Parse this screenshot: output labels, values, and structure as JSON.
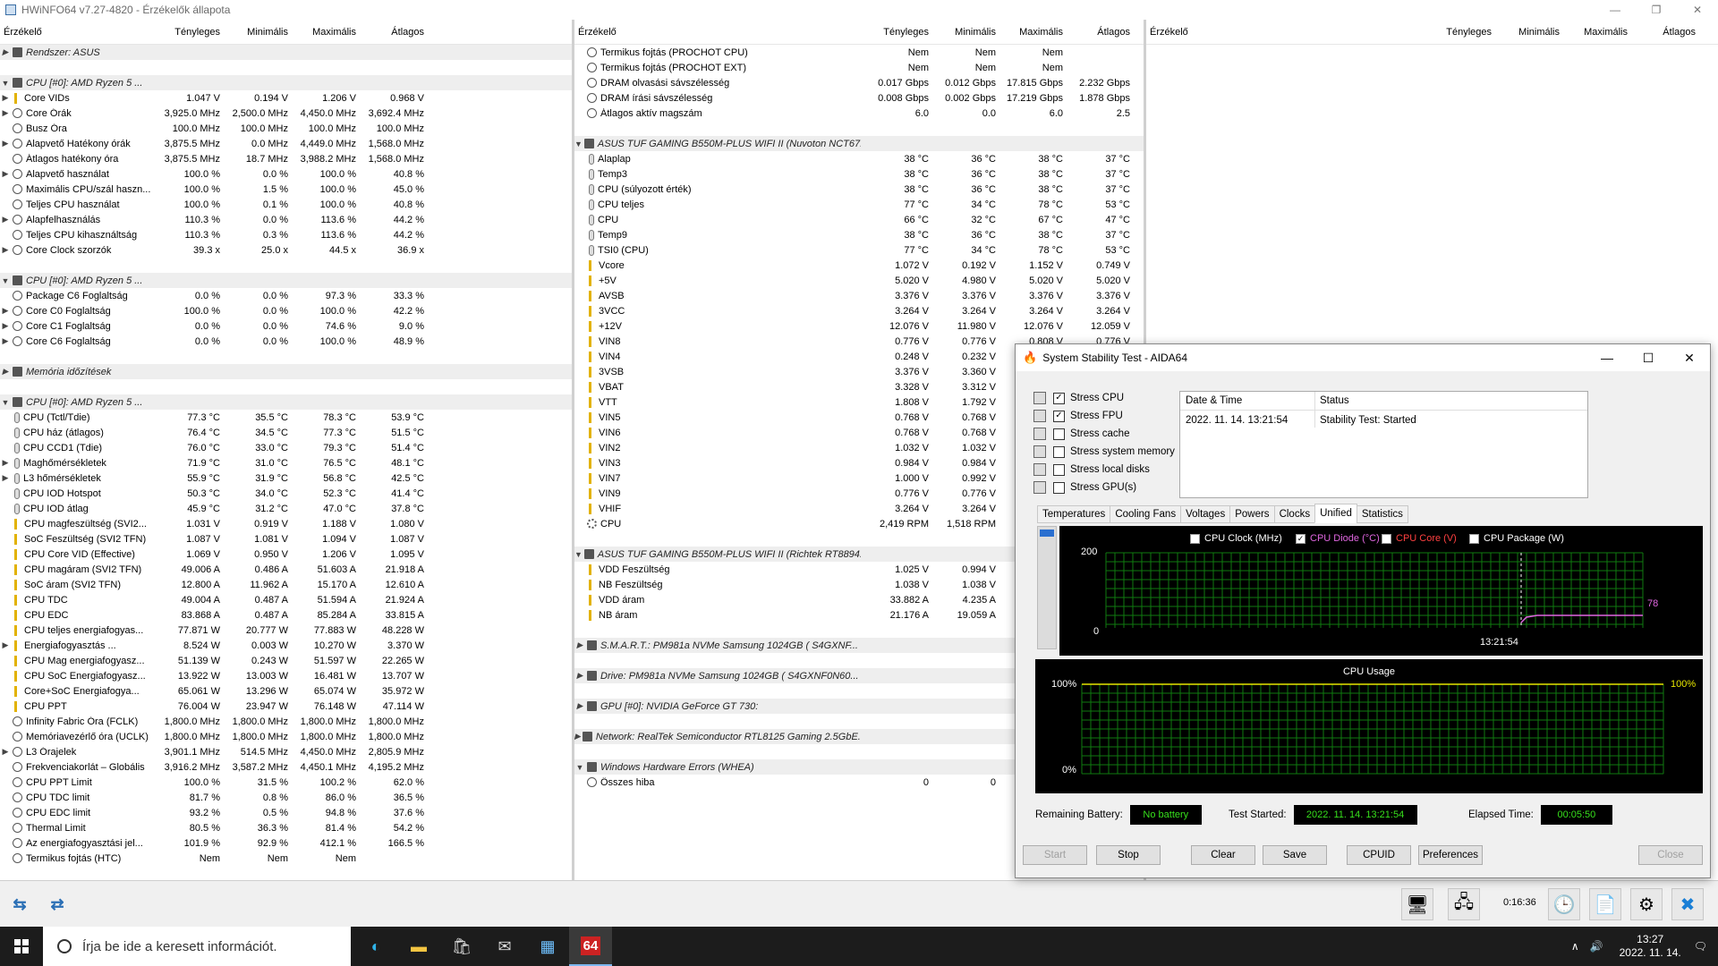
{
  "titlebar": {
    "title": "HWiNFO64 v7.27-4820 - Érzékelők állapota"
  },
  "columns": {
    "name": "Érzékelő",
    "current": "Tényleges",
    "min": "Minimális",
    "max": "Maximális",
    "avg": "Átlagos"
  },
  "pane1": [
    {
      "g": true,
      "e": "▶",
      "n": "Rendszer: ASUS"
    },
    {
      "s": true
    },
    {
      "g": true,
      "e": "▼",
      "n": "CPU [#0]: AMD Ryzen 5 ..."
    },
    {
      "e": "▶",
      "i": "volt",
      "n": "Core VIDs",
      "c": "1.047 V",
      "mi": "0.194 V",
      "ma": "1.206 V",
      "a": "0.968 V"
    },
    {
      "e": "▶",
      "i": "clock",
      "n": "Core Órák",
      "c": "3,925.0 MHz",
      "mi": "2,500.0 MHz",
      "ma": "4,450.0 MHz",
      "a": "3,692.4 MHz"
    },
    {
      "i": "clock",
      "n": "Busz Óra",
      "c": "100.0 MHz",
      "mi": "100.0 MHz",
      "ma": "100.0 MHz",
      "a": "100.0 MHz"
    },
    {
      "e": "▶",
      "i": "clock",
      "n": "Alapvető Hatékony órák",
      "c": "3,875.5 MHz",
      "mi": "0.0 MHz",
      "ma": "4,449.0 MHz",
      "a": "1,568.0 MHz"
    },
    {
      "i": "clock",
      "n": "Átlagos hatékony óra",
      "c": "3,875.5 MHz",
      "mi": "18.7 MHz",
      "ma": "3,988.2 MHz",
      "a": "1,568.0 MHz"
    },
    {
      "e": "▶",
      "i": "clock",
      "n": "Alapvető használat",
      "c": "100.0 %",
      "mi": "0.0 %",
      "ma": "100.0 %",
      "a": "40.8 %"
    },
    {
      "i": "clock",
      "n": "Maximális CPU/szál haszn...",
      "c": "100.0 %",
      "mi": "1.5 %",
      "ma": "100.0 %",
      "a": "45.0 %"
    },
    {
      "i": "clock",
      "n": "Teljes CPU használat",
      "c": "100.0 %",
      "mi": "0.1 %",
      "ma": "100.0 %",
      "a": "40.8 %"
    },
    {
      "e": "▶",
      "i": "clock",
      "n": "Alapfelhasználás",
      "c": "110.3 %",
      "mi": "0.0 %",
      "ma": "113.6 %",
      "a": "44.2 %"
    },
    {
      "i": "clock",
      "n": "Teljes CPU kihasználtság",
      "c": "110.3 %",
      "mi": "0.3 %",
      "ma": "113.6 %",
      "a": "44.2 %"
    },
    {
      "e": "▶",
      "i": "clock",
      "n": "Core Clock szorzók",
      "c": "39.3 x",
      "mi": "25.0 x",
      "ma": "44.5 x",
      "a": "36.9 x"
    },
    {
      "s": true
    },
    {
      "g": true,
      "e": "▼",
      "n": "CPU [#0]: AMD Ryzen 5 ..."
    },
    {
      "i": "clock",
      "n": "Package C6 Foglaltság",
      "c": "0.0 %",
      "mi": "0.0 %",
      "ma": "97.3 %",
      "a": "33.3 %"
    },
    {
      "e": "▶",
      "i": "clock",
      "n": "Core C0 Foglaltság",
      "c": "100.0 %",
      "mi": "0.0 %",
      "ma": "100.0 %",
      "a": "42.2 %"
    },
    {
      "e": "▶",
      "i": "clock",
      "n": "Core C1 Foglaltság",
      "c": "0.0 %",
      "mi": "0.0 %",
      "ma": "74.6 %",
      "a": "9.0 %"
    },
    {
      "e": "▶",
      "i": "clock",
      "n": "Core C6 Foglaltság",
      "c": "0.0 %",
      "mi": "0.0 %",
      "ma": "100.0 %",
      "a": "48.9 %"
    },
    {
      "s": true
    },
    {
      "g": true,
      "e": "▶",
      "n": "Memória időzítések"
    },
    {
      "s": true
    },
    {
      "g": true,
      "e": "▼",
      "n": "CPU [#0]: AMD Ryzen 5 ..."
    },
    {
      "i": "temp",
      "n": "CPU (Tctl/Tdie)",
      "c": "77.3 °C",
      "mi": "35.5 °C",
      "ma": "78.3 °C",
      "a": "53.9 °C"
    },
    {
      "i": "temp",
      "n": "CPU ház (átlagos)",
      "c": "76.4 °C",
      "mi": "34.5 °C",
      "ma": "77.3 °C",
      "a": "51.5 °C"
    },
    {
      "i": "temp",
      "n": "CPU CCD1 (Tdie)",
      "c": "76.0 °C",
      "mi": "33.0 °C",
      "ma": "79.3 °C",
      "a": "51.4 °C"
    },
    {
      "e": "▶",
      "i": "temp",
      "n": "Maghőmérsékletek",
      "c": "71.9 °C",
      "mi": "31.0 °C",
      "ma": "76.5 °C",
      "a": "48.1 °C"
    },
    {
      "e": "▶",
      "i": "temp",
      "n": "L3 hőmérsékletek",
      "c": "55.9 °C",
      "mi": "31.9 °C",
      "ma": "56.8 °C",
      "a": "42.5 °C"
    },
    {
      "i": "temp",
      "n": "CPU IOD Hotspot",
      "c": "50.3 °C",
      "mi": "34.0 °C",
      "ma": "52.3 °C",
      "a": "41.4 °C"
    },
    {
      "i": "temp",
      "n": "CPU IOD átlag",
      "c": "45.9 °C",
      "mi": "31.2 °C",
      "ma": "47.0 °C",
      "a": "37.8 °C"
    },
    {
      "i": "volt",
      "n": "CPU magfeszültség (SVI2...",
      "c": "1.031 V",
      "mi": "0.919 V",
      "ma": "1.188 V",
      "a": "1.080 V"
    },
    {
      "i": "volt",
      "n": "SoC Feszültség (SVI2 TFN)",
      "c": "1.087 V",
      "mi": "1.081 V",
      "ma": "1.094 V",
      "a": "1.087 V"
    },
    {
      "i": "volt",
      "n": "CPU Core VID (Effective)",
      "c": "1.069 V",
      "mi": "0.950 V",
      "ma": "1.206 V",
      "a": "1.095 V"
    },
    {
      "i": "volt",
      "n": "CPU magáram (SVI2 TFN)",
      "c": "49.006 A",
      "mi": "0.486 A",
      "ma": "51.603 A",
      "a": "21.918 A"
    },
    {
      "i": "volt",
      "n": "SoC áram (SVI2 TFN)",
      "c": "12.800 A",
      "mi": "11.962 A",
      "ma": "15.170 A",
      "a": "12.610 A"
    },
    {
      "i": "volt",
      "n": "CPU TDC",
      "c": "49.004 A",
      "mi": "0.487 A",
      "ma": "51.594 A",
      "a": "21.924 A"
    },
    {
      "i": "volt",
      "n": "CPU EDC",
      "c": "83.868 A",
      "mi": "0.487 A",
      "ma": "85.284 A",
      "a": "33.815 A"
    },
    {
      "i": "volt",
      "n": "CPU teljes energiafogyas...",
      "c": "77.871 W",
      "mi": "20.777 W",
      "ma": "77.883 W",
      "a": "48.228 W"
    },
    {
      "e": "▶",
      "i": "volt",
      "n": "Energiafogyasztás ...",
      "c": "8.524 W",
      "mi": "0.003 W",
      "ma": "10.270 W",
      "a": "3.370 W"
    },
    {
      "i": "volt",
      "n": "CPU Mag energiafogyasz...",
      "c": "51.139 W",
      "mi": "0.243 W",
      "ma": "51.597 W",
      "a": "22.265 W"
    },
    {
      "i": "volt",
      "n": "CPU SoC Energiafogyasz...",
      "c": "13.922 W",
      "mi": "13.003 W",
      "ma": "16.481 W",
      "a": "13.707 W"
    },
    {
      "i": "volt",
      "n": "Core+SoC Energiafogya...",
      "c": "65.061 W",
      "mi": "13.296 W",
      "ma": "65.074 W",
      "a": "35.972 W"
    },
    {
      "i": "volt",
      "n": "CPU PPT",
      "c": "76.004 W",
      "mi": "23.947 W",
      "ma": "76.148 W",
      "a": "47.114 W"
    },
    {
      "i": "clock",
      "n": "Infinity Fabric Óra (FCLK)",
      "c": "1,800.0 MHz",
      "mi": "1,800.0 MHz",
      "ma": "1,800.0 MHz",
      "a": "1,800.0 MHz"
    },
    {
      "i": "clock",
      "n": "Memóriavezérlő óra (UCLK)",
      "c": "1,800.0 MHz",
      "mi": "1,800.0 MHz",
      "ma": "1,800.0 MHz",
      "a": "1,800.0 MHz"
    },
    {
      "e": "▶",
      "i": "clock",
      "n": "L3 Órajelek",
      "c": "3,901.1 MHz",
      "mi": "514.5 MHz",
      "ma": "4,450.0 MHz",
      "a": "2,805.9 MHz"
    },
    {
      "i": "clock",
      "n": "Frekvenciakorlát – Globális",
      "c": "3,916.2 MHz",
      "mi": "3,587.2 MHz",
      "ma": "4,450.1 MHz",
      "a": "4,195.2 MHz"
    },
    {
      "i": "clock",
      "n": "CPU PPT Limit",
      "c": "100.0 %",
      "mi": "31.5 %",
      "ma": "100.2 %",
      "a": "62.0 %"
    },
    {
      "i": "clock",
      "n": "CPU TDC limit",
      "c": "81.7 %",
      "mi": "0.8 %",
      "ma": "86.0 %",
      "a": "36.5 %"
    },
    {
      "i": "clock",
      "n": "CPU EDC limit",
      "c": "93.2 %",
      "mi": "0.5 %",
      "ma": "94.8 %",
      "a": "37.6 %"
    },
    {
      "i": "clock",
      "n": "Thermal Limit",
      "c": "80.5 %",
      "mi": "36.3 %",
      "ma": "81.4 %",
      "a": "54.2 %"
    },
    {
      "i": "clock",
      "n": "Az energiafogyasztási jel...",
      "c": "101.9 %",
      "mi": "92.9 %",
      "ma": "412.1 %",
      "a": "166.5 %"
    },
    {
      "i": "clock",
      "n": "Termikus fojtás (HTC)",
      "c": "Nem",
      "mi": "Nem",
      "ma": "Nem",
      "a": ""
    }
  ],
  "pane2": [
    {
      "i": "clock",
      "n": "Termikus fojtás (PROCHOT CPU)",
      "c": "Nem",
      "mi": "Nem",
      "ma": "Nem",
      "a": ""
    },
    {
      "i": "clock",
      "n": "Termikus fojtás (PROCHOT EXT)",
      "c": "Nem",
      "mi": "Nem",
      "ma": "Nem",
      "a": ""
    },
    {
      "i": "clock",
      "n": "DRAM olvasási sávszélesség",
      "c": "0.017 Gbps",
      "mi": "0.012 Gbps",
      "ma": "17.815 Gbps",
      "a": "2.232 Gbps"
    },
    {
      "i": "clock",
      "n": "DRAM írási sávszélesség",
      "c": "0.008 Gbps",
      "mi": "0.002 Gbps",
      "ma": "17.219 Gbps",
      "a": "1.878 Gbps"
    },
    {
      "i": "clock",
      "n": "Átlagos aktív magszám",
      "c": "6.0",
      "mi": "0.0",
      "ma": "6.0",
      "a": "2.5"
    },
    {
      "s": true
    },
    {
      "g": true,
      "e": "▼",
      "n": "ASUS TUF GAMING B550M-PLUS WIFI II (Nuvoton NCT67..."
    },
    {
      "i": "temp",
      "n": "Alaplap",
      "c": "38 °C",
      "mi": "36 °C",
      "ma": "38 °C",
      "a": "37 °C"
    },
    {
      "i": "temp",
      "n": "Temp3",
      "c": "38 °C",
      "mi": "36 °C",
      "ma": "38 °C",
      "a": "37 °C"
    },
    {
      "i": "temp",
      "n": "CPU (súlyozott érték)",
      "c": "38 °C",
      "mi": "36 °C",
      "ma": "38 °C",
      "a": "37 °C"
    },
    {
      "i": "temp",
      "n": "CPU teljes",
      "c": "77 °C",
      "mi": "34 °C",
      "ma": "78 °C",
      "a": "53 °C"
    },
    {
      "i": "temp",
      "n": "CPU",
      "c": "66 °C",
      "mi": "32 °C",
      "ma": "67 °C",
      "a": "47 °C"
    },
    {
      "i": "temp",
      "n": "Temp9",
      "c": "38 °C",
      "mi": "36 °C",
      "ma": "38 °C",
      "a": "37 °C"
    },
    {
      "i": "temp",
      "n": "TSI0 (CPU)",
      "c": "77 °C",
      "mi": "34 °C",
      "ma": "78 °C",
      "a": "53 °C"
    },
    {
      "i": "volt",
      "n": "Vcore",
      "c": "1.072 V",
      "mi": "0.192 V",
      "ma": "1.152 V",
      "a": "0.749 V"
    },
    {
      "i": "volt",
      "n": "+5V",
      "c": "5.020 V",
      "mi": "4.980 V",
      "ma": "5.020 V",
      "a": "5.020 V"
    },
    {
      "i": "volt",
      "n": "AVSB",
      "c": "3.376 V",
      "mi": "3.376 V",
      "ma": "3.376 V",
      "a": "3.376 V"
    },
    {
      "i": "volt",
      "n": "3VCC",
      "c": "3.264 V",
      "mi": "3.264 V",
      "ma": "3.264 V",
      "a": "3.264 V"
    },
    {
      "i": "volt",
      "n": "+12V",
      "c": "12.076 V",
      "mi": "11.980 V",
      "ma": "12.076 V",
      "a": "12.059 V"
    },
    {
      "i": "volt",
      "n": "VIN8",
      "c": "0.776 V",
      "mi": "0.776 V",
      "ma": "0.808 V",
      "a": "0.776 V"
    },
    {
      "i": "volt",
      "n": "VIN4",
      "c": "0.248 V",
      "mi": "0.232 V",
      "ma": "",
      "a": ""
    },
    {
      "i": "volt",
      "n": "3VSB",
      "c": "3.376 V",
      "mi": "3.360 V",
      "ma": "",
      "a": ""
    },
    {
      "i": "volt",
      "n": "VBAT",
      "c": "3.328 V",
      "mi": "3.312 V",
      "ma": "",
      "a": ""
    },
    {
      "i": "volt",
      "n": "VTT",
      "c": "1.808 V",
      "mi": "1.792 V",
      "ma": "",
      "a": ""
    },
    {
      "i": "volt",
      "n": "VIN5",
      "c": "0.768 V",
      "mi": "0.768 V",
      "ma": "",
      "a": ""
    },
    {
      "i": "volt",
      "n": "VIN6",
      "c": "0.768 V",
      "mi": "0.768 V",
      "ma": "",
      "a": ""
    },
    {
      "i": "volt",
      "n": "VIN2",
      "c": "1.032 V",
      "mi": "1.032 V",
      "ma": "",
      "a": ""
    },
    {
      "i": "volt",
      "n": "VIN3",
      "c": "0.984 V",
      "mi": "0.984 V",
      "ma": "",
      "a": ""
    },
    {
      "i": "volt",
      "n": "VIN7",
      "c": "1.000 V",
      "mi": "0.992 V",
      "ma": "",
      "a": ""
    },
    {
      "i": "volt",
      "n": "VIN9",
      "c": "0.776 V",
      "mi": "0.776 V",
      "ma": "",
      "a": ""
    },
    {
      "i": "volt",
      "n": "VHIF",
      "c": "3.264 V",
      "mi": "3.264 V",
      "ma": "",
      "a": ""
    },
    {
      "i": "fan",
      "n": "CPU",
      "c": "2,419 RPM",
      "mi": "1,518 RPM",
      "ma": "",
      "a": ""
    },
    {
      "s": true
    },
    {
      "g": true,
      "e": "▼",
      "n": "ASUS TUF GAMING B550M-PLUS WIFI II (Richtek RT8894..."
    },
    {
      "i": "volt",
      "n": "VDD Feszültség",
      "c": "1.025 V",
      "mi": "0.994 V",
      "ma": "",
      "a": ""
    },
    {
      "i": "volt",
      "n": "NB Feszültség",
      "c": "1.038 V",
      "mi": "1.038 V",
      "ma": "",
      "a": ""
    },
    {
      "i": "volt",
      "n": "VDD áram",
      "c": "33.882 A",
      "mi": "4.235 A",
      "ma": "",
      "a": ""
    },
    {
      "i": "volt",
      "n": "NB áram",
      "c": "21.176 A",
      "mi": "19.059 A",
      "ma": "",
      "a": ""
    },
    {
      "s": true
    },
    {
      "g": true,
      "e": "▶",
      "n": "S.M.A.R.T.: PM981a NVMe Samsung 1024GB (      S4GXNF..."
    },
    {
      "s": true
    },
    {
      "g": true,
      "e": "▶",
      "n": "Drive: PM981a NVMe Samsung 1024GB (      S4GXNF0N60..."
    },
    {
      "s": true
    },
    {
      "g": true,
      "e": "▶",
      "n": "GPU [#0]: NVIDIA GeForce GT 730:"
    },
    {
      "s": true
    },
    {
      "g": true,
      "e": "▶",
      "n": "Network: RealTek Semiconductor RTL8125 Gaming 2.5GbE..."
    },
    {
      "s": true
    },
    {
      "g": true,
      "e": "▼",
      "n": "Windows Hardware Errors (WHEA)"
    },
    {
      "i": "clock",
      "n": "Összes hiba",
      "c": "0",
      "mi": "0",
      "ma": "",
      "a": ""
    }
  ],
  "bottombar": {
    "timer": "0:16:36"
  },
  "aida": {
    "title": "System Stability Test - AIDA64",
    "stress": [
      {
        "label": "Stress CPU",
        "checked": true,
        "mark": "✓"
      },
      {
        "label": "Stress FPU",
        "checked": true,
        "mark": "✓"
      },
      {
        "label": "Stress cache",
        "checked": false,
        "mark": ""
      },
      {
        "label": "Stress system memory",
        "checked": false,
        "mark": ""
      },
      {
        "label": "Stress local disks",
        "checked": false,
        "mark": ""
      },
      {
        "label": "Stress GPU(s)",
        "checked": false,
        "mark": ""
      }
    ],
    "status_head": {
      "date": "Date & Time",
      "status": "Status"
    },
    "status_row": {
      "date": "2022. 11. 14. 13:21:54",
      "status": "Stability Test: Started"
    },
    "tabs": [
      "Temperatures",
      "Cooling Fans",
      "Voltages",
      "Powers",
      "Clocks",
      "Unified",
      "Statistics"
    ],
    "active_tab": "Unified",
    "legend": [
      {
        "label": "CPU Clock (MHz)",
        "checked": false,
        "mark": "",
        "color": "#ffffff"
      },
      {
        "label": "CPU Diode (°C)",
        "checked": true,
        "mark": "✓",
        "color": "#e066e0"
      },
      {
        "label": "CPU Core (V)",
        "checked": false,
        "mark": "",
        "color": "#ff4040"
      },
      {
        "label": "CPU Package (W)",
        "checked": false,
        "mark": "",
        "color": "#ffffff"
      }
    ],
    "graph1": {
      "ymax": "200",
      "ymin": "0",
      "time": "13:21:54",
      "value": "78"
    },
    "graph2": {
      "title": "CPU Usage",
      "ymax": "100%",
      "ymin": "0%",
      "value": "100%"
    },
    "info": {
      "battery_label": "Remaining Battery:",
      "battery": "No battery",
      "started_label": "Test Started:",
      "started": "2022. 11. 14. 13:21:54",
      "elapsed_label": "Elapsed Time:",
      "elapsed": "00:05:50"
    },
    "buttons": {
      "start": "Start",
      "stop": "Stop",
      "clear": "Clear",
      "save": "Save",
      "cpuid": "CPUID",
      "prefs": "Preferences",
      "close": "Close"
    }
  },
  "taskbar": {
    "search": "Írja be ide a keresett információt.",
    "time": "13:27",
    "date": "2022. 11. 14."
  },
  "colors": {
    "grid": "#0f7a0f",
    "lcd": "#37e11c",
    "curve": "#e066e0"
  }
}
